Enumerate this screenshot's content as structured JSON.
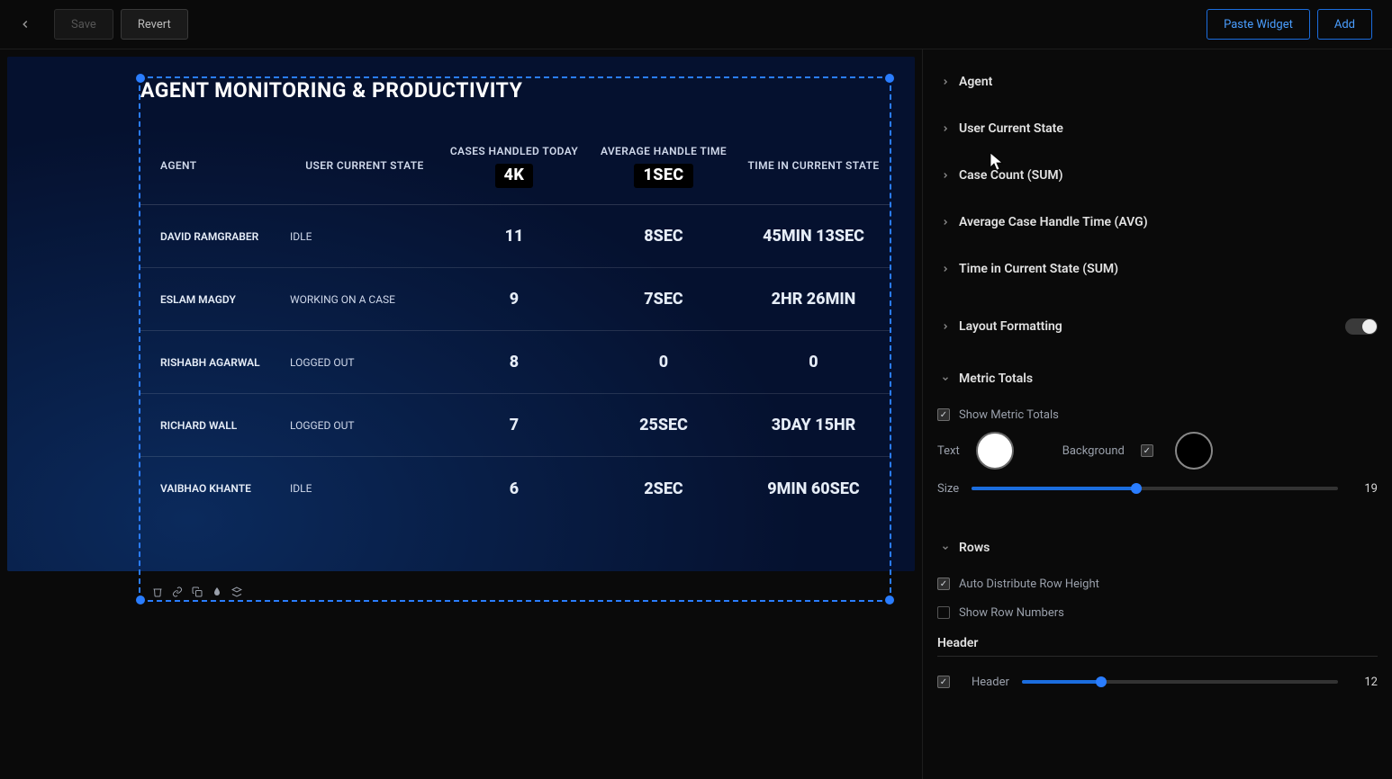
{
  "toolbar": {
    "save_label": "Save",
    "revert_label": "Revert",
    "paste_widget_label": "Paste Widget",
    "add_label": "Add"
  },
  "widget": {
    "title": "AGENT MONITORING & PRODUCTIVITY",
    "columns": {
      "agent": "AGENT",
      "user_state": "USER CURRENT STATE",
      "cases_today": "CASES HANDLED TODAY",
      "avg_handle": "AVERAGE HANDLE TIME",
      "time_state": "TIME IN CURRENT STATE"
    },
    "totals": {
      "cases_today": "4K",
      "avg_handle": "1SEC"
    },
    "rows": [
      {
        "agent": "DAVID RAMGRABER",
        "state": "IDLE",
        "cases": "11",
        "avg": "8SEC",
        "time": "45MIN  13SEC"
      },
      {
        "agent": "ESLAM MAGDY",
        "state": "WORKING ON A CASE",
        "cases": "9",
        "avg": "7SEC",
        "time": "2HR  26MIN"
      },
      {
        "agent": "RISHABH AGARWAL",
        "state": "LOGGED OUT",
        "cases": "8",
        "avg": "0",
        "time": "0"
      },
      {
        "agent": "RICHARD WALL",
        "state": "LOGGED OUT",
        "cases": "7",
        "avg": "25SEC",
        "time": "3DAY  15HR"
      },
      {
        "agent": "VAIBHAO KHANTE",
        "state": "IDLE",
        "cases": "6",
        "avg": "2SEC",
        "time": "9MIN  60SEC"
      }
    ]
  },
  "panel": {
    "fields": [
      "Agent",
      "User Current State",
      "Case Count (SUM)",
      "Average Case Handle Time (AVG)",
      "Time in Current State (SUM)"
    ],
    "layout_formatting_label": "Layout Formatting",
    "metric_totals": {
      "label": "Metric Totals",
      "show_label": "Show Metric Totals",
      "text_label": "Text",
      "background_label": "Background",
      "size_label": "Size",
      "text_color": "#ffffff",
      "background_color": "#000000",
      "size_value": "19"
    },
    "rows_section": {
      "label": "Rows",
      "auto_distribute_label": "Auto Distribute Row Height",
      "show_numbers_label": "Show Row Numbers",
      "header_label": "Header",
      "header_checkbox_label": "Header",
      "header_size_value": "12"
    }
  }
}
